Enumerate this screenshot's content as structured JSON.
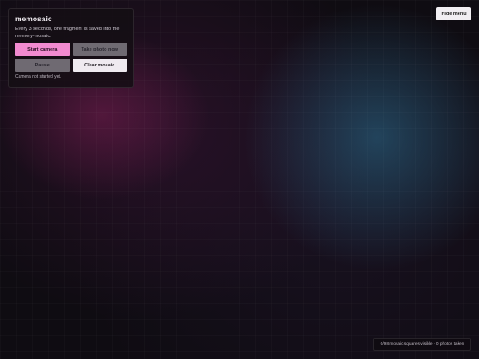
{
  "panel": {
    "title": "memosaic",
    "description": "Every 3 seconds, one fragment is saved into the memory-mosaic.",
    "buttons": {
      "start": "Start camera",
      "take_photo": "Take photo now",
      "pause": "Pause",
      "clear": "Clear mosaic"
    },
    "status": "Camera not started yet."
  },
  "hide_menu_label": "Hide menu",
  "footer_status": "0/98 mosaic squares visible · 0 photos taken",
  "colors": {
    "start_button": "#f28bd0",
    "disabled_button": "#6f6a72",
    "clear_button": "#efeaf0",
    "background": "#0f0c12"
  }
}
